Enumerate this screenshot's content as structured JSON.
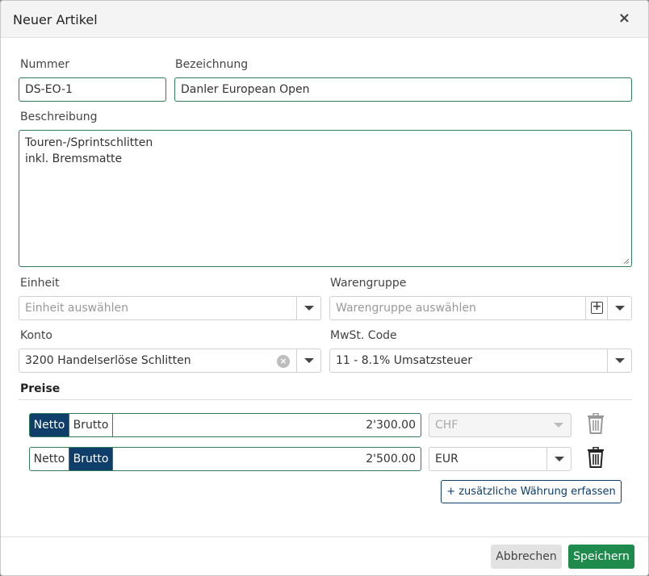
{
  "dialog": {
    "title": "Neuer Artikel",
    "close_label": "×"
  },
  "form": {
    "nummer": {
      "label": "Nummer",
      "value": "DS-EO-1"
    },
    "bezeichnung": {
      "label": "Bezeichnung",
      "value": "Danler European Open"
    },
    "beschreibung": {
      "label": "Beschreibung",
      "value": "Touren-/Sprintschlitten\ninkl. Bremsmatte"
    },
    "einheit": {
      "label": "Einheit",
      "placeholder": "Einheit auswählen"
    },
    "warengruppe": {
      "label": "Warengruppe",
      "placeholder": "Warengruppe auswählen",
      "add_label": "+"
    },
    "konto": {
      "label": "Konto",
      "value": "3200 Handelserlöse Schlitten",
      "clear_label": "×"
    },
    "mwst": {
      "label": "MwSt. Code",
      "value": "11 - 8.1% Umsatzsteuer"
    }
  },
  "prices": {
    "title": "Preise",
    "rows": [
      {
        "netto_label": "Netto",
        "brutto_label": "Brutto",
        "active": "netto",
        "amount": "2'300.00",
        "currency": "CHF",
        "currency_disabled": true
      },
      {
        "netto_label": "Netto",
        "brutto_label": "Brutto",
        "active": "brutto",
        "amount": "2'500.00",
        "currency": "EUR",
        "currency_disabled": false
      }
    ],
    "add_currency_label": "+ zusätzliche Währung erfassen"
  },
  "footer": {
    "cancel_label": "Abbrechen",
    "save_label": "Speichern"
  },
  "colors": {
    "accent_green": "#2e7d5b",
    "segment_active": "#0f3e6b",
    "save_button": "#1e8a4c"
  },
  "icons": {
    "close": "close-icon",
    "trash": "trash-icon",
    "dropdown": "chevron-down-icon",
    "add": "plus-square-icon",
    "clear": "clear-circle-icon"
  }
}
